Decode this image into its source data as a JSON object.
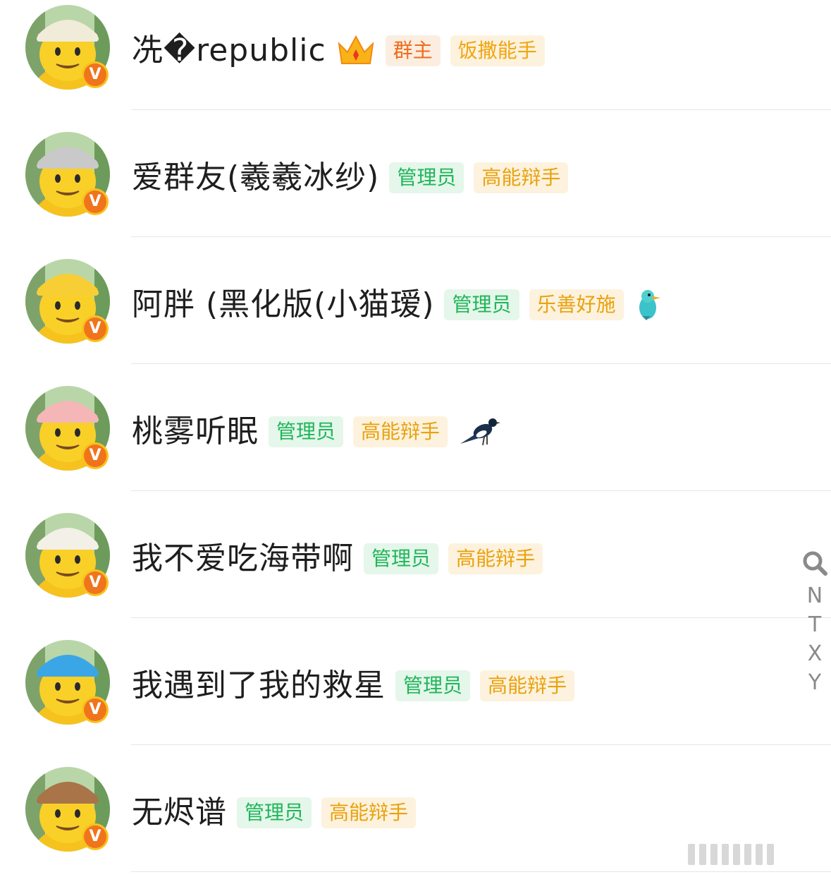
{
  "members": [
    {
      "name": "冼�republic",
      "avatar_icon": "yellow-mascot-cream-bunny-hat-avatar",
      "hat_color": "#f1ebd9",
      "badge_icon": "v-verified-badge",
      "badge_letter": "V",
      "decor_icon": "crown-icon",
      "tags": [
        {
          "text": "群主",
          "kind": "orange"
        },
        {
          "text": "饭撒能手",
          "kind": "yellow"
        }
      ]
    },
    {
      "name": "爱群友(羲羲冰纱)",
      "avatar_icon": "yellow-mascot-grey-mouse-hat-avatar",
      "hat_color": "#c9c9c9",
      "badge_icon": "v-verified-badge",
      "badge_letter": "V",
      "decor_icon": "",
      "tags": [
        {
          "text": "管理员",
          "kind": "green"
        },
        {
          "text": "高能辩手",
          "kind": "gold"
        }
      ]
    },
    {
      "name": "阿胖 (黑化版(小猫瑷)",
      "avatar_icon": "yellow-mascot-duck-hat-avatar",
      "hat_color": "#f7cf35",
      "badge_icon": "v-verified-badge",
      "badge_letter": "V",
      "decor_icon": "teal-bird-icon",
      "tags": [
        {
          "text": "管理员",
          "kind": "green"
        },
        {
          "text": "乐善好施",
          "kind": "gold"
        }
      ]
    },
    {
      "name": "桃雾听眠",
      "avatar_icon": "yellow-mascot-pink-pig-hat-avatar",
      "hat_color": "#f4b6b6",
      "badge_icon": "v-verified-badge",
      "badge_letter": "V",
      "decor_icon": "magpie-icon",
      "tags": [
        {
          "text": "管理员",
          "kind": "green"
        },
        {
          "text": "高能辩手",
          "kind": "gold"
        }
      ]
    },
    {
      "name": "我不爱吃海带啊",
      "avatar_icon": "yellow-mascot-white-bear-hat-avatar",
      "hat_color": "#f3f0e8",
      "badge_icon": "v-verified-badge",
      "badge_letter": "V",
      "decor_icon": "",
      "tags": [
        {
          "text": "管理员",
          "kind": "green"
        },
        {
          "text": "高能辩手",
          "kind": "gold"
        }
      ]
    },
    {
      "name": "我遇到了我的救星",
      "avatar_icon": "yellow-mascot-blue-cat-hat-avatar",
      "hat_color": "#3aa6e6",
      "badge_icon": "v-verified-badge",
      "badge_letter": "V",
      "decor_icon": "",
      "tags": [
        {
          "text": "管理员",
          "kind": "green"
        },
        {
          "text": "高能辩手",
          "kind": "gold"
        }
      ]
    },
    {
      "name": "无烬谱",
      "avatar_icon": "yellow-mascot-brown-bear-hat-avatar",
      "hat_color": "#a87448",
      "badge_icon": "v-verified-badge",
      "badge_letter": "V",
      "decor_icon": "",
      "tags": [
        {
          "text": "管理员",
          "kind": "green"
        },
        {
          "text": "高能辩手",
          "kind": "gold"
        }
      ]
    }
  ],
  "index_bar": {
    "search_icon": "search-icon",
    "letters": [
      "N",
      "T",
      "X",
      "Y"
    ]
  },
  "colors": {
    "tag_orange_text": "#f26a1b",
    "tag_yellow_text": "#f0a511",
    "tag_green_text": "#1fb65a",
    "badge_orange": "#f0741c",
    "mascot_yellow": "#f9d028"
  }
}
